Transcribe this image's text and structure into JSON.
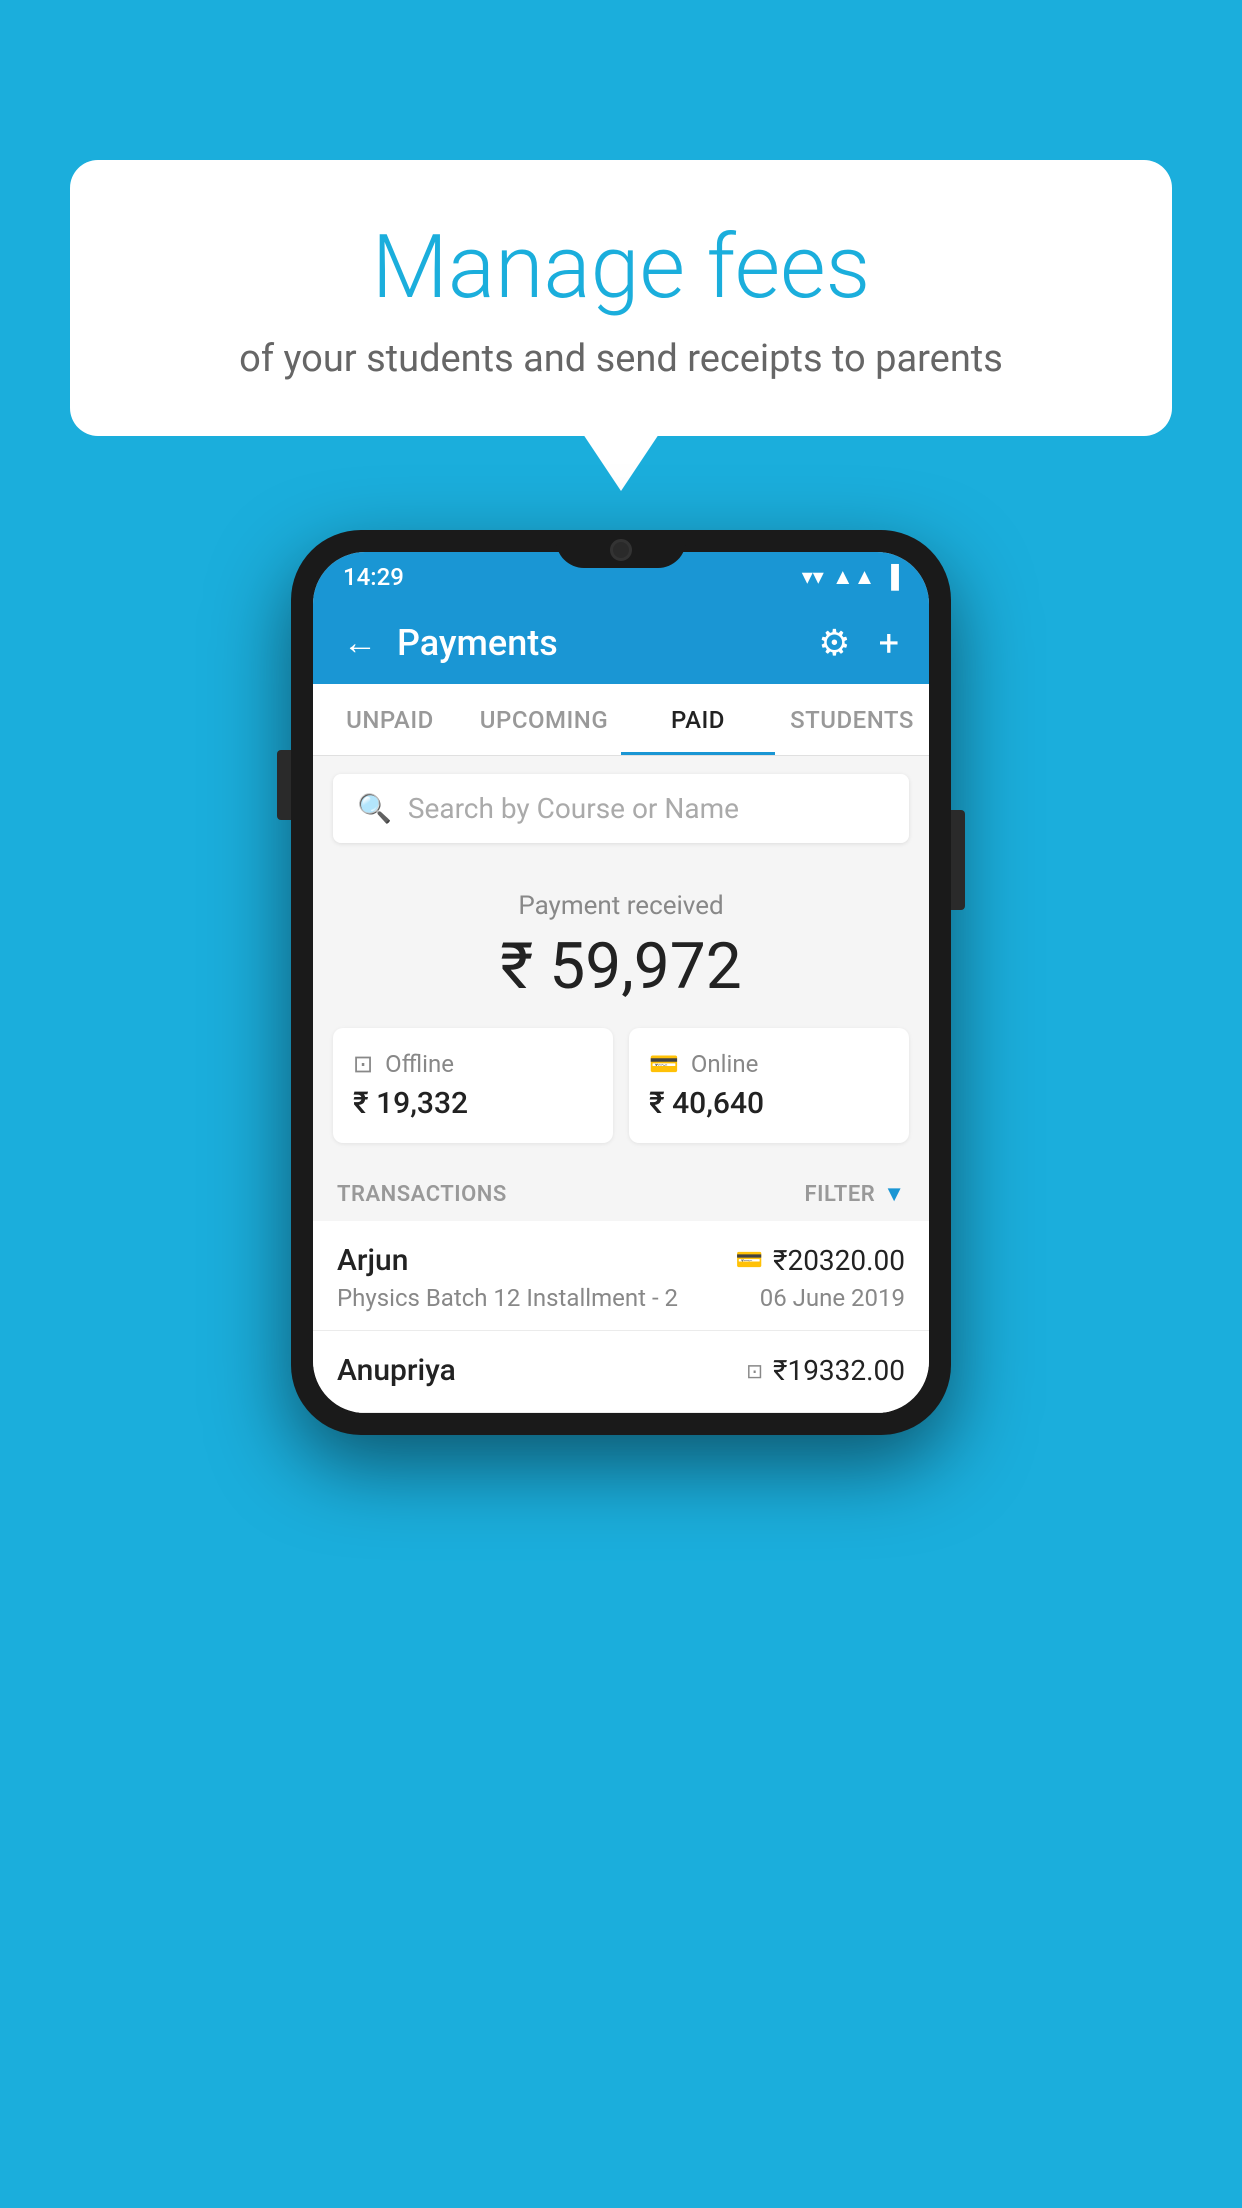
{
  "background_color": "#1BAEDC",
  "speech_bubble": {
    "title": "Manage fees",
    "subtitle": "of your students and send receipts to parents"
  },
  "status_bar": {
    "time": "14:29",
    "wifi": "▾",
    "signal": "▲",
    "battery": "▌"
  },
  "header": {
    "title": "Payments",
    "back_label": "←",
    "gear_label": "⚙",
    "plus_label": "+"
  },
  "tabs": [
    {
      "label": "UNPAID",
      "active": false
    },
    {
      "label": "UPCOMING",
      "active": false
    },
    {
      "label": "PAID",
      "active": true
    },
    {
      "label": "STUDENTS",
      "active": false
    }
  ],
  "search": {
    "placeholder": "Search by Course or Name"
  },
  "payment_summary": {
    "label": "Payment received",
    "total": "₹ 59,972",
    "offline": {
      "label": "Offline",
      "amount": "₹ 19,332"
    },
    "online": {
      "label": "Online",
      "amount": "₹ 40,640"
    }
  },
  "transactions": {
    "label": "TRANSACTIONS",
    "filter_label": "FILTER",
    "items": [
      {
        "name": "Arjun",
        "description": "Physics Batch 12 Installment - 2",
        "amount": "₹20320.00",
        "date": "06 June 2019",
        "payment_type": "card"
      },
      {
        "name": "Anupriya",
        "description": "",
        "amount": "₹19332.00",
        "date": "",
        "payment_type": "cash"
      }
    ]
  }
}
